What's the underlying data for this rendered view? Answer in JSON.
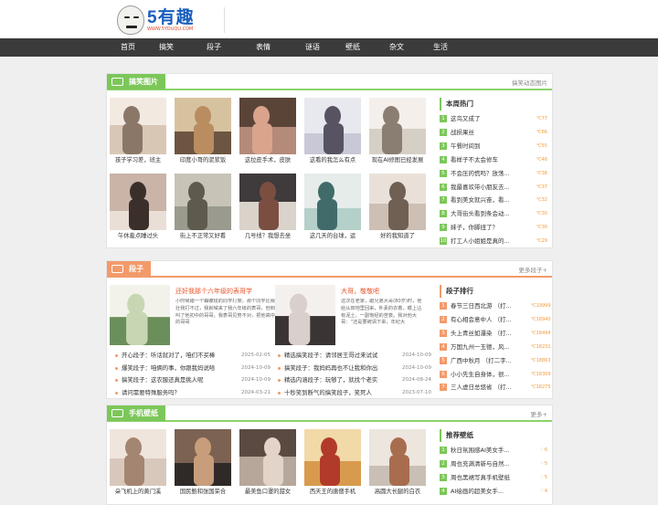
{
  "site": {
    "name": "5有趣",
    "domain": "WWW.5YOUQU.COM"
  },
  "nav": [
    "首页",
    "搞笑",
    "段子",
    "表情",
    "谜语",
    "壁纸",
    "杂文",
    "生活"
  ],
  "funny": {
    "title": "搞笑图片",
    "more": "搞笑动态图片",
    "thumbs": [
      {
        "caption": "孩子学习差，班主",
        "colors": [
          "#d9c7b6",
          "#8a7768",
          "#f2e9e1"
        ]
      },
      {
        "caption": "印度小哥的泥浆饭",
        "colors": [
          "#6c5542",
          "#b98d5f",
          "#d7c2a0"
        ]
      },
      {
        "caption": "这拉皮手术，皮肤",
        "colors": [
          "#b48a79",
          "#d9a38c",
          "#5a4438"
        ]
      },
      {
        "caption": "这看的我怎么有点",
        "colors": [
          "#c8c8d6",
          "#575363",
          "#e8e8ef"
        ]
      },
      {
        "caption": "现在AI修图已经发展",
        "colors": [
          "#d6cfc6",
          "#8a7d72",
          "#f4efea"
        ]
      },
      {
        "caption": "午休羞点睡过头",
        "colors": [
          "#e9dfd7",
          "#3a2f2b",
          "#c9b4a7"
        ]
      },
      {
        "caption": "街上不正常又好看",
        "colors": [
          "#9a9a8e",
          "#5f5a4e",
          "#c7c3b6"
        ]
      },
      {
        "caption": "几号线？我想去坐",
        "colors": [
          "#d9d3cb",
          "#7b4e42",
          "#3f3a3b"
        ]
      },
      {
        "caption": "这几天的台球，运",
        "colors": [
          "#b4d0c9",
          "#416b6b",
          "#e5ece9"
        ]
      },
      {
        "caption": "好的我知道了",
        "colors": [
          "#cdbfb4",
          "#706054",
          "#e9e1d9"
        ]
      }
    ],
    "side": {
      "title": "本周热门",
      "items": [
        {
          "rank": "1",
          "text": "这鸟又成了",
          "value": "77"
        },
        {
          "rank": "2",
          "text": "战损果丝",
          "value": "66"
        },
        {
          "rank": "3",
          "text": "午餐时间到",
          "value": "55"
        },
        {
          "rank": "4",
          "text": "看样子不太会修车",
          "value": "48"
        },
        {
          "rank": "5",
          "text": "不会压的慌吗？放荡...",
          "value": "38"
        },
        {
          "rank": "6",
          "text": "我最喜欢带小朋友去...",
          "value": "37"
        },
        {
          "rank": "7",
          "text": "看到美女就兴奋，看...",
          "value": "32"
        },
        {
          "rank": "8",
          "text": "大哥街头看到条会动...",
          "value": "30"
        },
        {
          "rank": "9",
          "text": "妹子，你脚扭了？",
          "value": "30"
        },
        {
          "rank": "10",
          "text": "打工人小姐姐是真的...",
          "value": "29"
        }
      ]
    }
  },
  "jokes": {
    "title": "段子",
    "more": "更多段子+",
    "features": [
      {
        "title": "还好我那个六年级的表哥学",
        "desc": "小时候跟一个蝴蝶班的同学打架，那个同学比我壮我打不过，我就喊来了我六年级的表哥，他到叫了他初中的哥哥，我表哥见势不对，把他高中的哥哥",
        "colors": [
          "#6b8f5a",
          "#c7d7b4",
          "#f2f2ea"
        ]
      },
      {
        "title": "大哥，敬敬吧",
        "desc": "这次在老家，跟兄弟大哥(80岁)时，他给从田地里回来，朴素的衣着，眼上沾有泥土，一副饱经的苦衰。我对他大哥：“还是要被讽下来，年纪大",
        "colors": [
          "#3a3434",
          "#d9cfcb",
          "#f4f0ee"
        ]
      }
    ],
    "list_left": [
      {
        "text": "开心段子：听话就对了，咱们不买棒",
        "date": "2025-02-05"
      },
      {
        "text": "爆笑段子：咱俩的事，你跟我妈说哈",
        "date": "2024-10-09"
      },
      {
        "text": "搞笑段子：这农服还真是挑人呢",
        "date": "2024-10-09"
      },
      {
        "text": "请问需要特殊服务吗？",
        "date": "2024-03-21"
      }
    ],
    "list_right": [
      {
        "text": "精选搞笑段子：请邻居王哥过来试试",
        "date": "2024-10-09"
      },
      {
        "text": "搞笑段子：我妈妈再也不让我和你出",
        "date": "2024-10-09"
      },
      {
        "text": "精选内涵段子：玩够了，就找个老实",
        "date": "2024-08-24"
      },
      {
        "text": "十秒笑到断气的搞笑段子，笑死人",
        "date": "2023-07-10"
      }
    ],
    "side": {
      "title": "段子排行",
      "items": [
        {
          "rank": "1",
          "text": "春节三日西北游 （打...",
          "value": "19999"
        },
        {
          "rank": "2",
          "text": "有心相会意中人 （打...",
          "value": "18940"
        },
        {
          "rank": "3",
          "text": "头上青丝如瀑染 （打...",
          "value": "18494"
        },
        {
          "rank": "4",
          "text": "万国九州一玉德，风...",
          "value": "18231"
        },
        {
          "rank": "5",
          "text": "广西中秋月 （打二字...",
          "value": "18863"
        },
        {
          "rank": "6",
          "text": "小小先生自身体，很...",
          "value": "18309"
        },
        {
          "rank": "7",
          "text": "三人虚日总悠省 （打...",
          "value": "18275"
        }
      ]
    }
  },
  "wall": {
    "title": "手机壁纸",
    "more": "更多+",
    "thumbs": [
      {
        "caption": "朵飞机上的黄门溪",
        "colors": [
          "#d8c8bb",
          "#a48572",
          "#efe5dc"
        ]
      },
      {
        "caption": "国民鲍和张国荣合",
        "colors": [
          "#2f2a28",
          "#c89d7c",
          "#7b6252"
        ]
      },
      {
        "caption": "最美鱼口罩的甜女",
        "colors": [
          "#b7a79a",
          "#e2d4c8",
          "#5b4a41"
        ]
      },
      {
        "caption": "西天王的唐僧手机",
        "colors": [
          "#d89b4d",
          "#b23a2b",
          "#f1d9a8"
        ]
      },
      {
        "caption": "高圆大长腿的白衣",
        "colors": [
          "#c9bfb5",
          "#a86d4f",
          "#ece6de"
        ]
      }
    ],
    "side": {
      "title": "推荐壁纸",
      "items": [
        {
          "rank": "1",
          "text": "秋日氛围感AI美女手...",
          "value": "6"
        },
        {
          "rank": "2",
          "text": "周也充满清新与自然...",
          "value": "5"
        },
        {
          "rank": "3",
          "text": "周也黑裙写真手机壁纸",
          "value": "5"
        },
        {
          "rank": "4",
          "text": "AI绘画的超美女手...",
          "value": "4"
        }
      ]
    }
  }
}
